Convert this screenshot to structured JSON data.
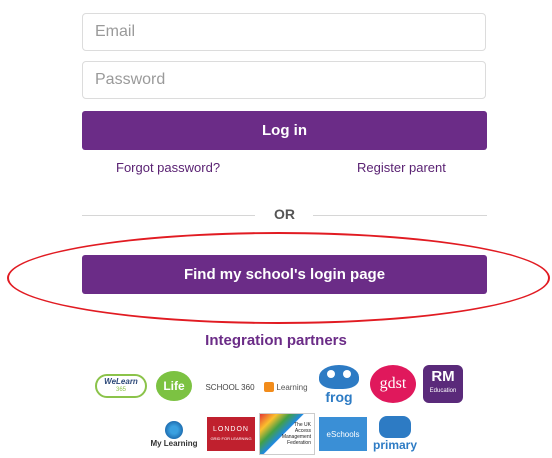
{
  "login_form": {
    "email_placeholder": "Email",
    "password_placeholder": "Password",
    "login_button": "Log in",
    "forgot_password": "Forgot password?",
    "register_parent": "Register parent",
    "divider_text": "OR",
    "find_school_button": "Find my school's login page"
  },
  "partners": {
    "title": "Integration partners",
    "logos": [
      {
        "name": "WeLearn 365",
        "text_lines": [
          "WeLearn",
          "365"
        ]
      },
      {
        "name": "Life",
        "text": "Life"
      },
      {
        "name": "School 360",
        "text": "SCHOOL 360"
      },
      {
        "name": "Learning",
        "text": "Learning"
      },
      {
        "name": "Frog",
        "text": "frog"
      },
      {
        "name": "gdst",
        "text": "gdst"
      },
      {
        "name": "RM Education",
        "text": "RM",
        "subtext": "Education"
      },
      {
        "name": "My Learning",
        "text": "My Learning"
      },
      {
        "name": "London Grid for Learning",
        "text": "LONDON",
        "subtext": "GRID FOR LEARNING"
      },
      {
        "name": "The UK Access Management Federation",
        "text_lines": [
          "The UK",
          "Access",
          "Management",
          "Federation"
        ]
      },
      {
        "name": "eSchools",
        "text": "eSchools"
      },
      {
        "name": "Primary",
        "text": "primary"
      }
    ]
  },
  "colors": {
    "brand_purple": "#6b2c87",
    "annotation_red": "#e11b22"
  }
}
